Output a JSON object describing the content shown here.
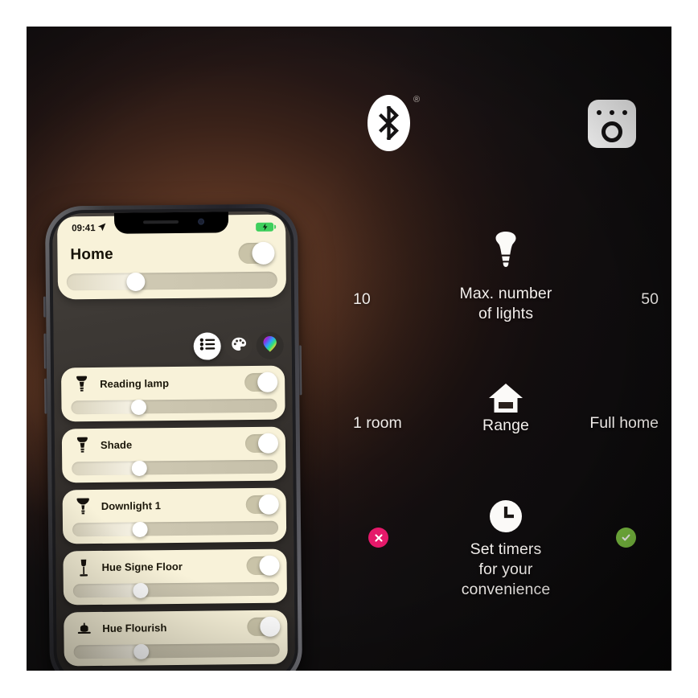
{
  "scene": {
    "background_dark": "#151314",
    "glow_color": "#7b4a30"
  },
  "logos": {
    "bluetooth": {
      "name": "bluetooth-logo",
      "registered_mark": "®"
    },
    "bridge": {
      "name": "hue-bridge-logo"
    }
  },
  "features": [
    {
      "icon": "bulb-icon",
      "left_value": "10",
      "center_label": "Max. number\nof lights",
      "center_label_line1": "Max. number",
      "center_label_line2": "of lights",
      "right_value": "50"
    },
    {
      "icon": "house-icon",
      "left_value": "1 room",
      "center_label": "Range",
      "right_value": "Full home"
    },
    {
      "icon": "clock-icon",
      "left_value": "",
      "center_label_line1": "Set timers",
      "center_label_line2": "for your",
      "center_label_line3": "convenience",
      "right_value": "",
      "left_badge": "cross-badge",
      "right_badge": "check-badge"
    }
  ],
  "badge_colors": {
    "cross": "#e5196a",
    "check": "#7dc242"
  },
  "phone": {
    "status_bar": {
      "time": "09:41",
      "location_icon": "location-arrow-icon",
      "battery_icon": "battery-charging-icon",
      "battery_color": "#3ecf5c"
    },
    "header": {
      "title": "Home",
      "toggle_state": "on",
      "brightness_percent": 33
    },
    "segmented": [
      {
        "name": "list-view",
        "icon": "list-icon",
        "active": true
      },
      {
        "name": "scenes-view",
        "icon": "palette-icon",
        "active": false
      },
      {
        "name": "color-view",
        "icon": "color-bulb-icon",
        "active": false
      }
    ],
    "lights": [
      {
        "name": "Reading lamp",
        "icon": "spot-bulb-icon",
        "toggle_state": "on",
        "brightness_percent": 33
      },
      {
        "name": "Shade",
        "icon": "spot-bulb-icon",
        "toggle_state": "on",
        "brightness_percent": 33
      },
      {
        "name": "Downlight 1",
        "icon": "downlight-icon",
        "toggle_state": "on",
        "brightness_percent": 33
      },
      {
        "name": "Hue Signe Floor",
        "icon": "floor-lamp-icon",
        "toggle_state": "on",
        "brightness_percent": 33
      },
      {
        "name": "Hue Flourish",
        "icon": "pendant-lamp-icon",
        "toggle_state": "on",
        "brightness_percent": 33
      }
    ],
    "card_color": "#f8f2d9"
  }
}
